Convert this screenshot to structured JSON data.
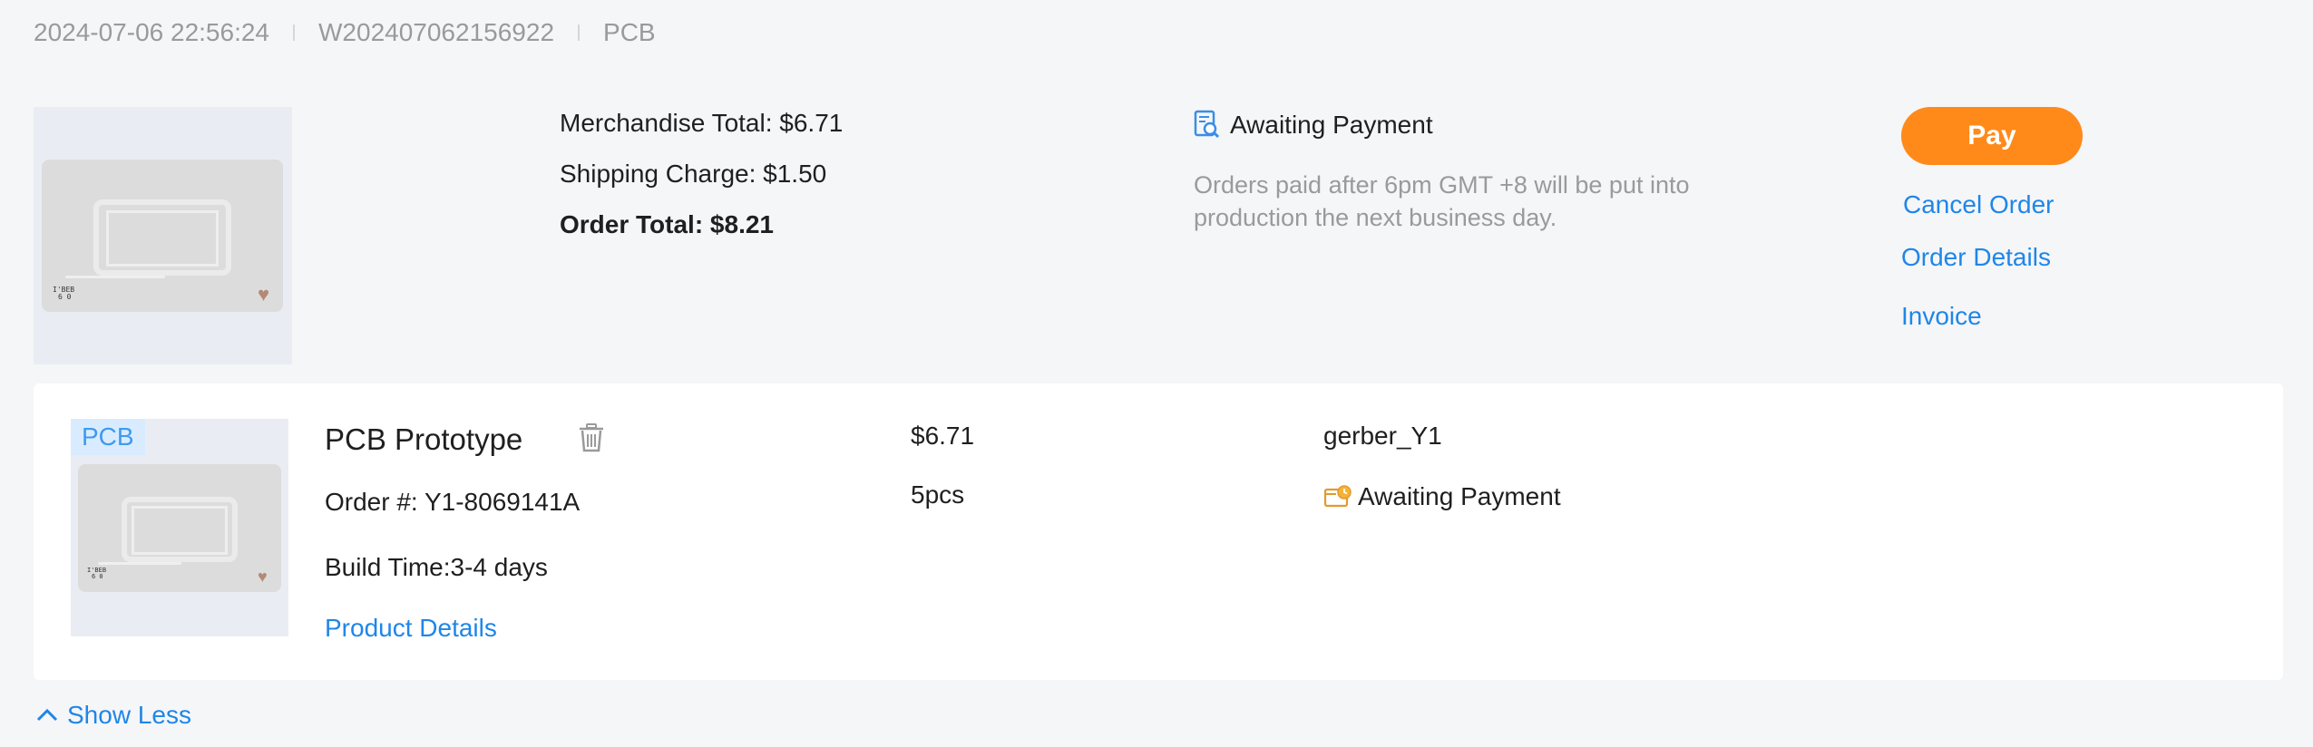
{
  "order_header": {
    "datetime": "2024-07-06 22:56:24",
    "order_number": "W202407062156922",
    "category": "PCB"
  },
  "summary": {
    "merchandise_total": "Merchandise Total: $6.71",
    "shipping_charge": "Shipping Charge: $1.50",
    "order_total": "Order Total: $8.21"
  },
  "status": {
    "label": "Awaiting Payment",
    "note": "Orders paid after 6pm GMT +8 will be put into production the next business day."
  },
  "actions": {
    "pay": "Pay",
    "cancel_order": "Cancel Order",
    "order_details": "Order Details",
    "invoice": "Invoice"
  },
  "item": {
    "tag": "PCB",
    "title": "PCB Prototype",
    "order_no": "Order #: Y1-8069141A",
    "build_time": "Build Time:3-4 days",
    "product_details": "Product Details",
    "price": "$6.71",
    "quantity": "5pcs",
    "file": "gerber_Y1",
    "status": "Awaiting Payment"
  },
  "footer": {
    "show_less": "Show Less"
  },
  "thumbnail": {
    "chip_label_top": "I'BEB",
    "chip_label_bottom": "6 0"
  },
  "colors": {
    "accent_blue": "#1f86e8",
    "pay_orange": "#ff8a1a",
    "muted_text": "#9a9a9a",
    "page_bg": "#f5f6f8"
  }
}
